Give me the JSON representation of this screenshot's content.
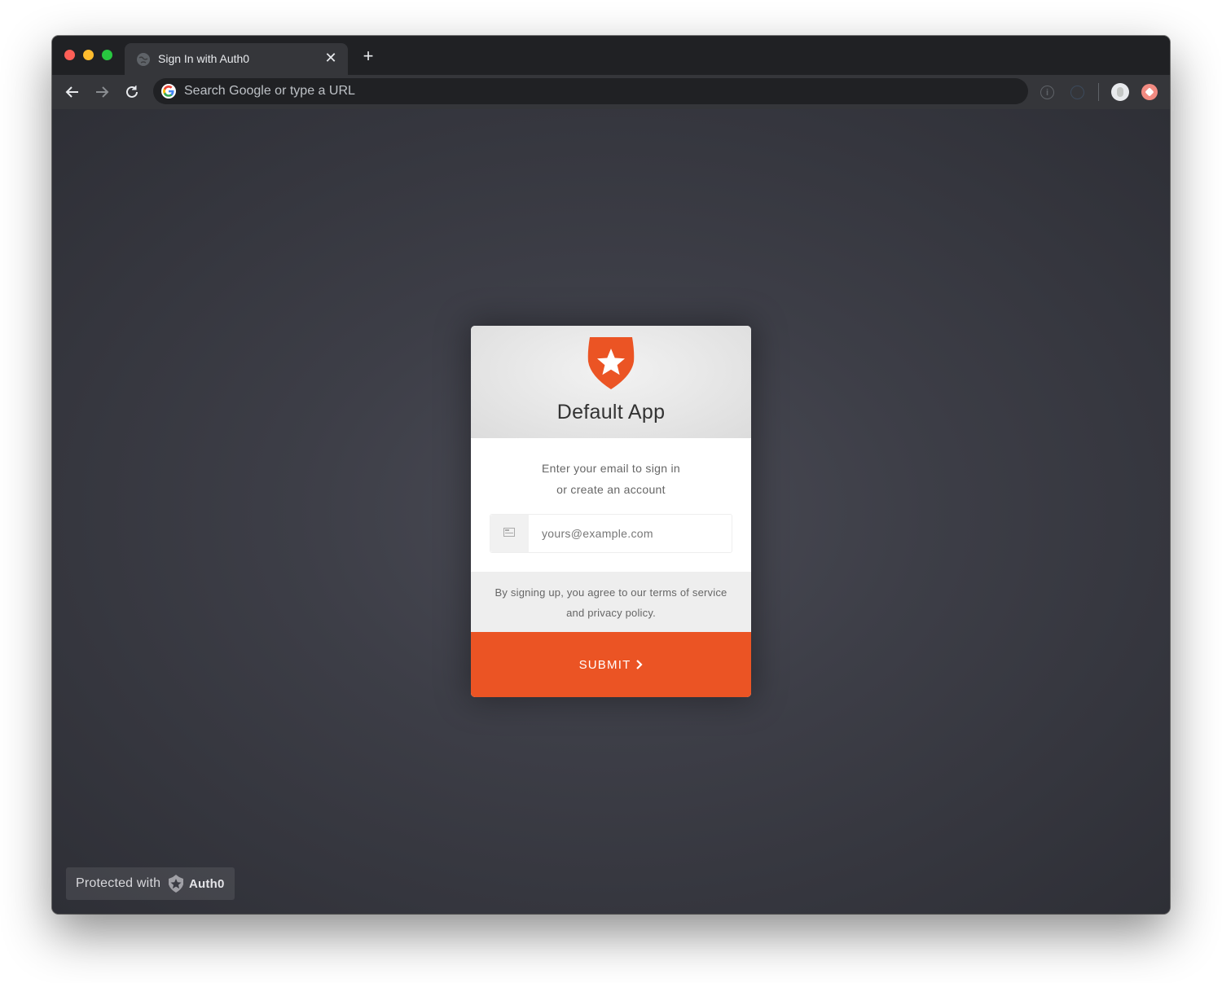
{
  "browser": {
    "tab": {
      "title": "Sign In with Auth0",
      "close_glyph": "✕",
      "favicon": "globe-icon"
    },
    "new_tab_glyph": "+",
    "omnibox": {
      "placeholder": "Search Google or type a URL",
      "value": ""
    }
  },
  "login": {
    "app_name": "Default App",
    "instructions_line1": "Enter your email to sign in",
    "instructions_line2": "or create an account",
    "email_placeholder": "yours@example.com",
    "terms_line1": "By signing up, you agree to our terms of service",
    "terms_line2": "and privacy policy.",
    "submit_label": "SUBMIT"
  },
  "badge": {
    "prefix": "Protected with",
    "brand": "Auth0"
  },
  "colors": {
    "accent": "#eb5424",
    "background": "#3d3e47",
    "chrome": "#202124"
  }
}
